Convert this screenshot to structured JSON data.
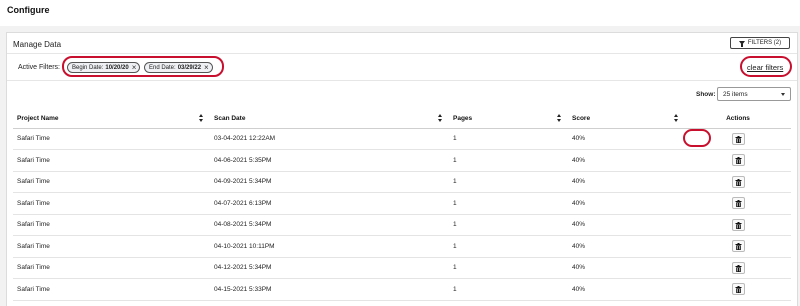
{
  "header": {
    "title": "Configure"
  },
  "panel": {
    "title": "Manage Data",
    "filters_button": "FILTERS (2)",
    "active_filters_label": "Active Filters:",
    "filters": [
      {
        "label": "Begin Date:",
        "value": "10/20/20"
      },
      {
        "label": "End Date:",
        "value": "03/29/22"
      }
    ],
    "clear_filters": "clear filters",
    "show_label": "Show:",
    "show_value": "25 items"
  },
  "table": {
    "columns": [
      "Project Name",
      "Scan Date",
      "Pages",
      "Score",
      "Actions"
    ],
    "rows": [
      {
        "project": "Safari Time",
        "date": "03-04-2021 12:22AM",
        "pages": "1",
        "score": "40%"
      },
      {
        "project": "Safari Time",
        "date": "04-06-2021 5:35PM",
        "pages": "1",
        "score": "40%"
      },
      {
        "project": "Safari Time",
        "date": "04-09-2021 5:34PM",
        "pages": "1",
        "score": "40%"
      },
      {
        "project": "Safari Time",
        "date": "04-07-2021 6:13PM",
        "pages": "1",
        "score": "40%"
      },
      {
        "project": "Safari Time",
        "date": "04-08-2021 5:34PM",
        "pages": "1",
        "score": "40%"
      },
      {
        "project": "Safari Time",
        "date": "04-10-2021 10:11PM",
        "pages": "1",
        "score": "40%"
      },
      {
        "project": "Safari Time",
        "date": "04-12-2021 5:34PM",
        "pages": "1",
        "score": "40%"
      },
      {
        "project": "Safari Time",
        "date": "04-15-2021 5:33PM",
        "pages": "1",
        "score": "40%"
      }
    ]
  },
  "icons": {
    "filter": "funnel-icon",
    "delete": "trash-icon",
    "remove_filter": "close-icon",
    "sort": "sort-icon",
    "dropdown": "chevron-down-icon"
  },
  "colors": {
    "highlight": "#c8102e"
  }
}
